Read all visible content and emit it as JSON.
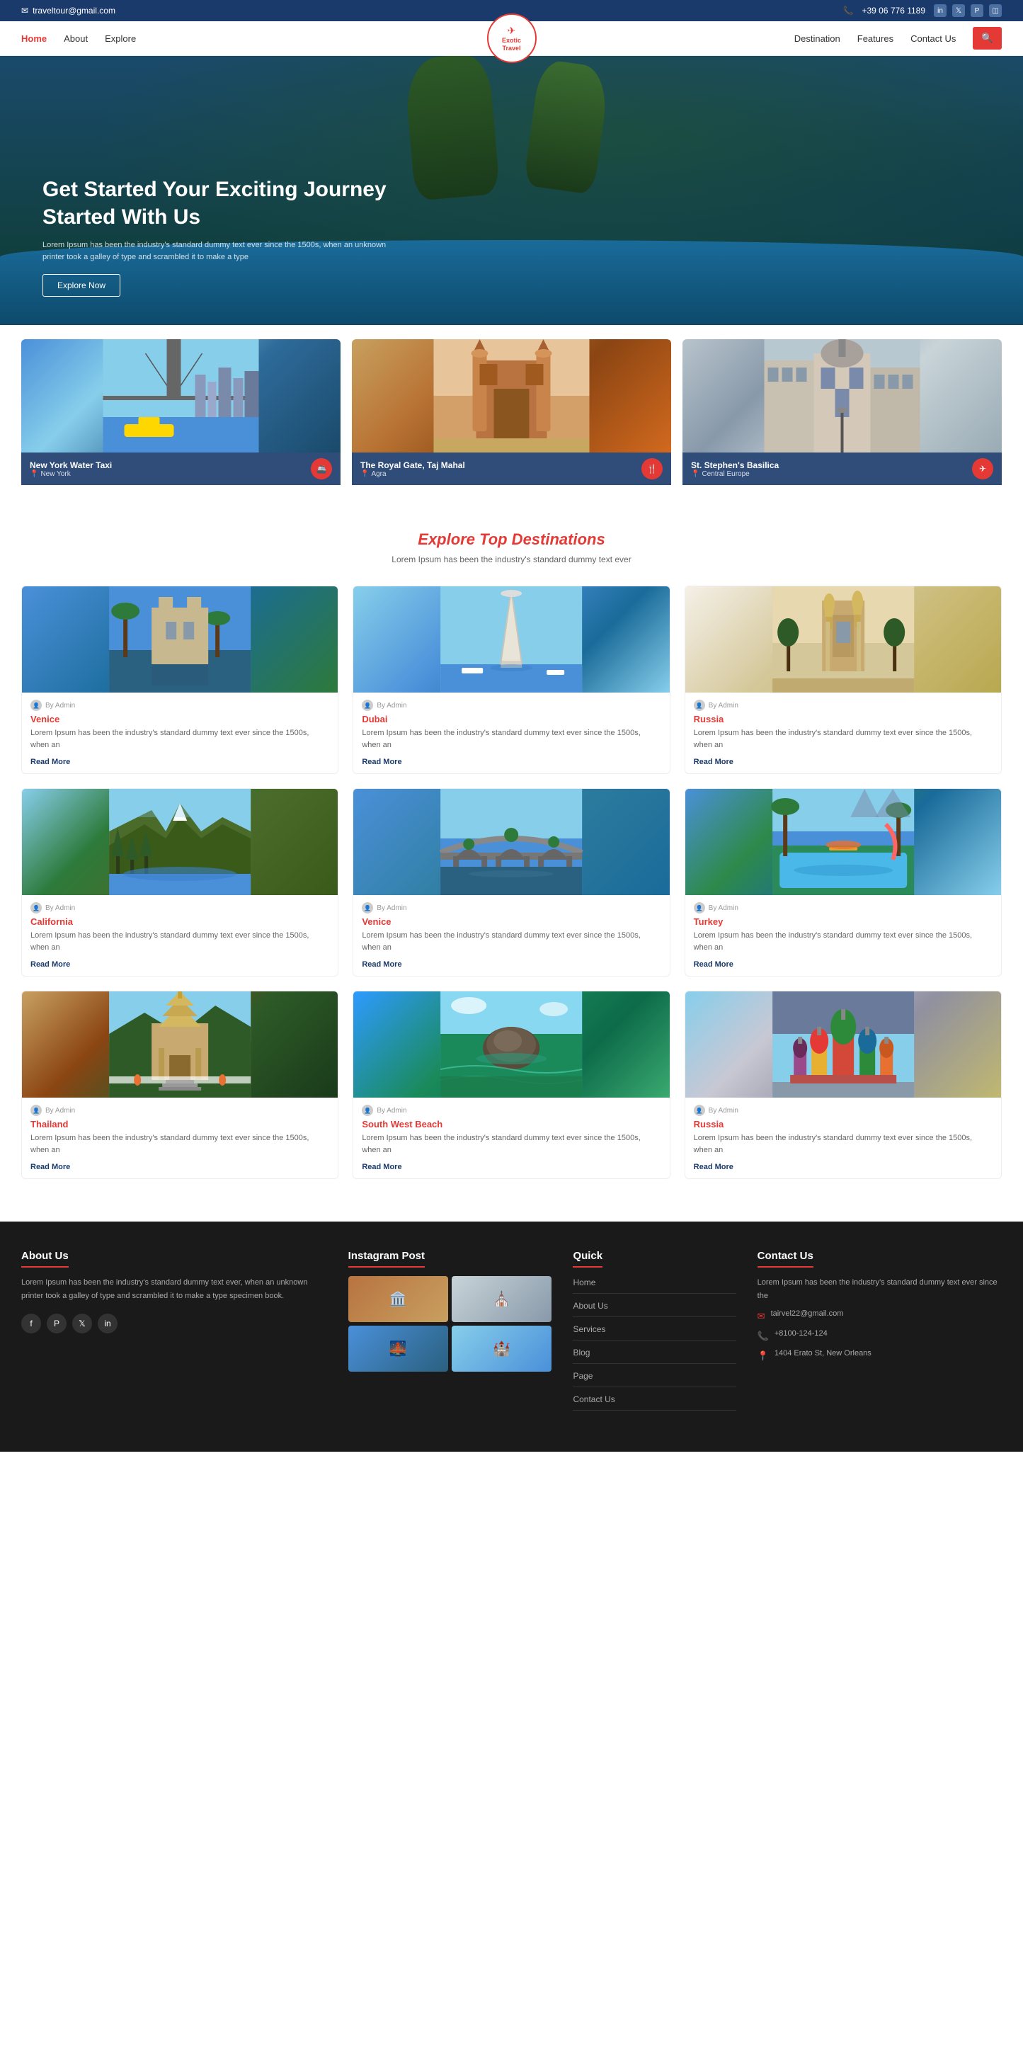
{
  "topbar": {
    "email": "traveltour@gmail.com",
    "phone": "+39 06 776 1189"
  },
  "nav": {
    "links": [
      {
        "label": "Home",
        "active": true
      },
      {
        "label": "About"
      },
      {
        "label": "Explore"
      },
      {
        "label": "Destination"
      },
      {
        "label": "Features"
      },
      {
        "label": "Contact Us"
      }
    ],
    "logo_line1": "Exotic",
    "logo_line2": "Travel"
  },
  "hero": {
    "title": "Get Started Your Exciting Journey Started With Us",
    "subtitle": "Lorem Ipsum has been the industry's standard dummy text ever since the 1500s, when an unknown printer took a galley of type and scrambled it to make a type",
    "btn_label": "Explore Now"
  },
  "featured": [
    {
      "name": "New York Water Taxi",
      "location": "New York",
      "icon": "🚢",
      "theme": "nyc"
    },
    {
      "name": "The Royal Gate, Taj Mahal",
      "location": "Agra",
      "icon": "🍽️",
      "theme": "agra"
    },
    {
      "name": "St. Stephen's Basilica",
      "location": "Central Europe",
      "icon": "✈️",
      "theme": "europe"
    }
  ],
  "explore": {
    "title": "Explore Top Destinations",
    "subtitle": "Lorem Ipsum has been the industry's standard dummy text ever"
  },
  "destinations": [
    {
      "name": "Venice",
      "by": "By Admin",
      "desc": "Lorem Ipsum has been the industry's standard dummy text ever since the 1500s, when an",
      "read_more": "Read More",
      "theme": "venice"
    },
    {
      "name": "Dubai",
      "by": "By Admin",
      "desc": "Lorem Ipsum has been the industry's standard dummy text ever since the 1500s, when an",
      "read_more": "Read More",
      "theme": "dubai"
    },
    {
      "name": "Russia",
      "by": "By Admin",
      "desc": "Lorem Ipsum has been the industry's standard dummy text ever since the 1500s, when an",
      "read_more": "Read More",
      "theme": "russia"
    },
    {
      "name": "California",
      "by": "By Admin",
      "desc": "Lorem Ipsum has been the industry's standard dummy text ever since the 1500s, when an",
      "read_more": "Read More",
      "theme": "california"
    },
    {
      "name": "Venice",
      "by": "By Admin",
      "desc": "Lorem Ipsum has been the industry's standard dummy text ever since the 1500s, when an",
      "read_more": "Read More",
      "theme": "venice2"
    },
    {
      "name": "Turkey",
      "by": "By Admin",
      "desc": "Lorem Ipsum has been the industry's standard dummy text ever since the 1500s, when an",
      "read_more": "Read More",
      "theme": "turkey"
    },
    {
      "name": "Thailand",
      "by": "By Admin",
      "desc": "Lorem Ipsum has been the industry's standard dummy text ever since the 1500s, when an",
      "read_more": "Read More",
      "theme": "thailand"
    },
    {
      "name": "South West Beach",
      "by": "By Admin",
      "desc": "Lorem Ipsum has been the industry's standard dummy text ever since the 1500s, when an",
      "read_more": "Read More",
      "theme": "swbeach"
    },
    {
      "name": "Russia",
      "by": "By Admin",
      "desc": "Lorem Ipsum has been the industry's standard dummy text ever since the 1500s, when an",
      "read_more": "Read More",
      "theme": "russia2"
    }
  ],
  "footer": {
    "about_title": "About Us",
    "about_text": "Lorem Ipsum has been the industry's standard dummy text ever, when an unknown printer took a galley of type and scrambled it to make a type specimen book.",
    "instagram_title": "Instagram Post",
    "quick_title": "Quick",
    "quick_links": [
      "Home",
      "About Us",
      "Services",
      "Blog",
      "Page",
      "Contact Us"
    ],
    "contact_title": "Contact Us",
    "contact_text": "Lorem Ipsum has been the industry's standard dummy text ever since the",
    "contact_email": "tairvel22@gmail.com",
    "contact_phone": "+8100-124-124",
    "contact_address": "1404 Erato St, New Orleans"
  },
  "icons": {
    "email": "✉",
    "phone": "📞",
    "search": "🔍",
    "pin": "📍",
    "user": "👤",
    "plane": "✈",
    "ship": "🚢",
    "fork": "🍴",
    "map": "📍",
    "mail": "✉",
    "call": "📞",
    "location": "📍"
  }
}
